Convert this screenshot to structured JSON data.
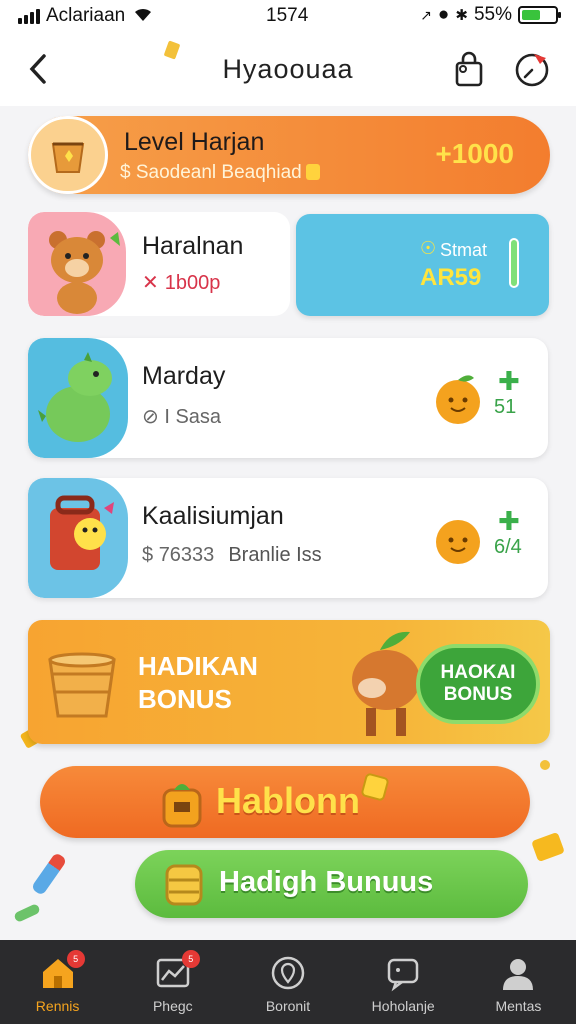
{
  "status_bar": {
    "carrier": "Aclariaan",
    "time": "1574",
    "battery": "55%",
    "battery_level": 0.55
  },
  "header": {
    "title": "Hyaoouaa"
  },
  "level_banner": {
    "title": "Level Harjan",
    "subtitle": "Saodeanl Beaqhiad",
    "points": "+1000"
  },
  "cards": [
    {
      "name": "Haralnan",
      "sub": "1b00p"
    },
    {
      "name": "Marday",
      "sub": "I Sasa",
      "fruit_count": "51"
    },
    {
      "name": "Kaalisiumjan",
      "sub": "76333",
      "sub2": "Branlie Iss",
      "fruit_count": "6/4"
    }
  ],
  "stat_card": {
    "label": "Stmat",
    "value": "AR59"
  },
  "bonus_banner": {
    "title": "HADIKAN BONUS",
    "pill": "HAOKAI BONUS"
  },
  "buttons": {
    "orange": "Hablonn",
    "green": "Hadigh Bunuus"
  },
  "tabs": [
    {
      "label": "Rennis",
      "badge": "5"
    },
    {
      "label": "Phegc",
      "badge": "5"
    },
    {
      "label": "Boronit"
    },
    {
      "label": "Hoholanje"
    },
    {
      "label": "Mentas"
    }
  ],
  "colors": {
    "accent_orange": "#f37d2e",
    "accent_green": "#5cbb3e",
    "teal": "#5cc3e4",
    "tab_active": "#f5a41e"
  }
}
